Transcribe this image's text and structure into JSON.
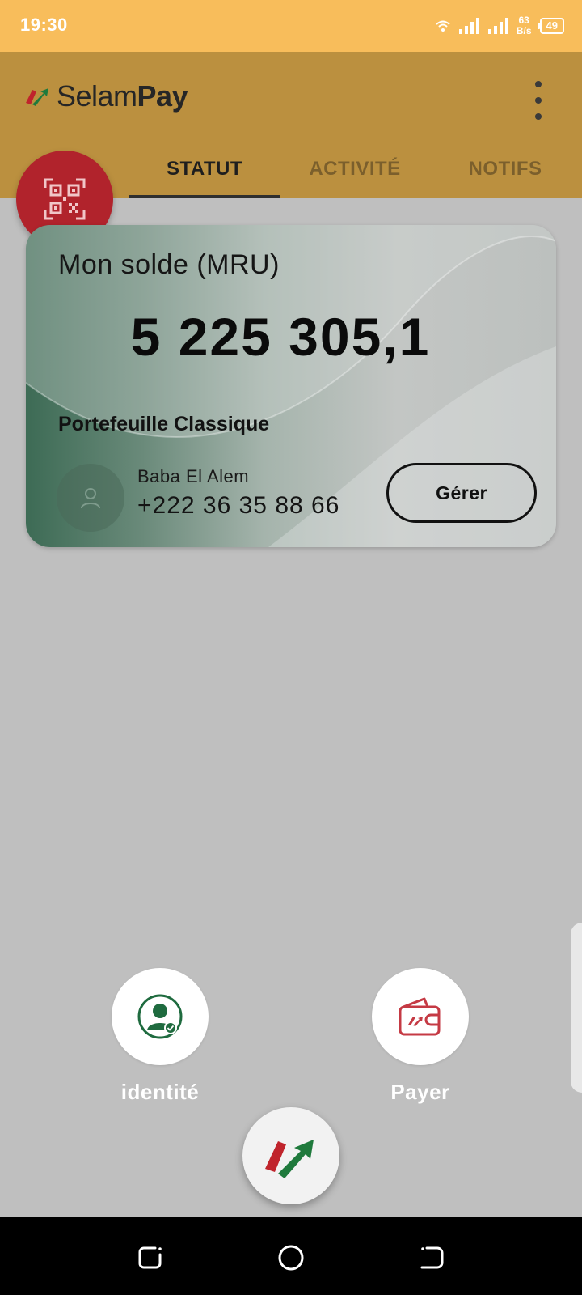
{
  "status_bar": {
    "time": "19:30",
    "net_speed_value": "63",
    "net_speed_unit": "B/s",
    "battery": "49"
  },
  "app": {
    "logo_light": "Selam",
    "logo_bold": "Pay"
  },
  "tabs": [
    {
      "label": "STATUT",
      "selected": true
    },
    {
      "label": "ACTIVITÉ",
      "selected": false
    },
    {
      "label": "NOTIFS",
      "selected": false
    }
  ],
  "card": {
    "title": "Mon solde (MRU)",
    "amount": "5 225 305,1",
    "wallet_type": "Portefeuille Classique",
    "owner_name": "Baba El Alem",
    "owner_phone": "+222 36 35 88 66",
    "manage_label": "Gérer"
  },
  "actions": [
    {
      "label": "identité",
      "icon": "identity-icon"
    },
    {
      "label": "Payer",
      "icon": "wallet-pay-icon"
    }
  ],
  "colors": {
    "status_bar": "#f8bd5b",
    "app_bar": "#bb903f",
    "background": "#bfbfbf",
    "brand_red": "#b1232c",
    "brand_green": "#1f7a3c"
  }
}
